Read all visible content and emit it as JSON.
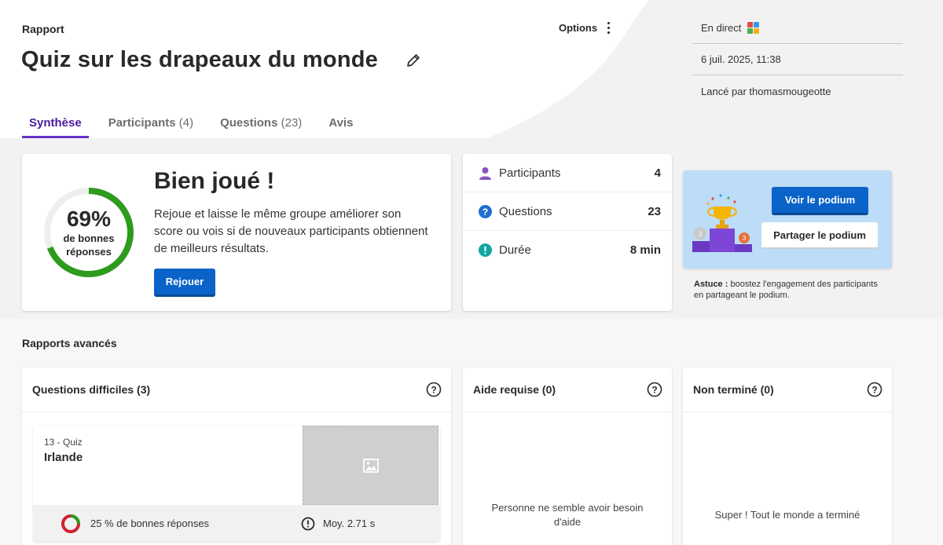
{
  "header": {
    "section_label": "Rapport",
    "title": "Quiz sur les drapeaux du monde",
    "options_label": "Options"
  },
  "tabs": [
    {
      "label": "Synthèse",
      "count": ""
    },
    {
      "label": "Participants",
      "count": "(4)"
    },
    {
      "label": "Questions",
      "count": "(23)"
    },
    {
      "label": "Avis",
      "count": ""
    }
  ],
  "meta": {
    "status": "En direct",
    "date": "6 juil. 2025, 11:38",
    "launched_by": "Lancé par thomasmougeotte"
  },
  "score": {
    "percent": 69,
    "percent_label": "69%",
    "caption": "de bonnes réponses",
    "headline": "Bien joué !",
    "message": "Rejoue et laisse le même groupe améliorer son score ou vois si de nouveaux participants obtiennent de meilleurs résultats.",
    "replay_label": "Rejouer"
  },
  "stats": [
    {
      "label": "Participants",
      "value": "4",
      "icon": "person-icon",
      "color": "#8854c0"
    },
    {
      "label": "Questions",
      "value": "23",
      "icon": "question-circle-icon",
      "color": "#1d6fd1"
    },
    {
      "label": "Durée",
      "value": "8 min",
      "icon": "timer-icon",
      "color": "#13a5a4"
    }
  ],
  "podium": {
    "view_label": "Voir le podium",
    "share_label": "Partager le podium",
    "tip_bold": "Astuce :",
    "tip_text": " boostez l'engagement des participants en partageant le podium."
  },
  "advanced": {
    "title": "Rapports avancés",
    "hard_questions": {
      "title": "Questions difficiles (3)",
      "item": {
        "meta": "13 - Quiz",
        "name": "Irlande",
        "correct_fraction": 0.25,
        "correct_label": "25 % de bonnes réponses",
        "avg_time_label": "Moy. 2.71 s"
      }
    },
    "help_needed": {
      "title": "Aide requise (0)",
      "message": "Personne ne semble avoir besoin d'aide"
    },
    "not_finished": {
      "title": "Non terminé (0)",
      "message": "Super ! Tout le monde a terminé"
    }
  },
  "colors": {
    "accent": "#6631c7",
    "primary_button": "#0a63c8",
    "score_green": "#2e9a1e",
    "wrong_red": "#d0212f"
  }
}
